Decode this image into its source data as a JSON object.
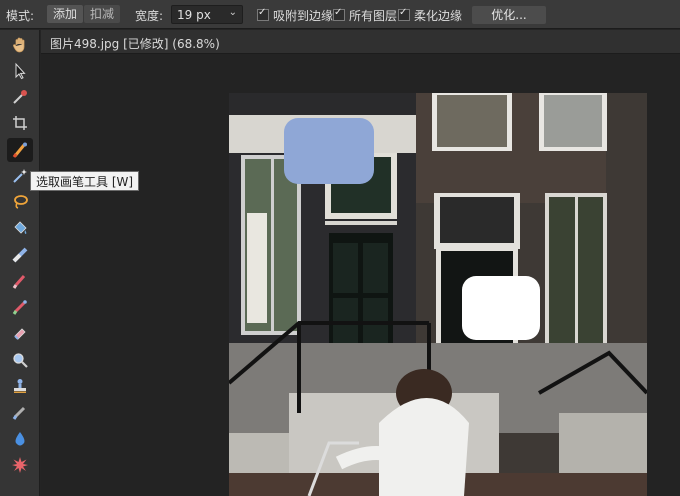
{
  "options_bar": {
    "mode_label": "模式:",
    "add_label": "添加",
    "subtract_label": "扣减",
    "width_label": "宽度:",
    "width_value": "19 px",
    "snap_edges_label": "吸附到边缘",
    "all_layers_label": "所有图层",
    "smooth_edges_label": "柔化边缘",
    "optimize_label": "优化..."
  },
  "document": {
    "tab_title": "图片498.jpg [已修改] (68.8%)"
  },
  "tooltip": {
    "text": "选取画笔工具 [W]"
  },
  "toolbar": {
    "tools": [
      {
        "name": "hand-tool-icon"
      },
      {
        "name": "move-arrow-icon"
      },
      {
        "name": "eyedropper-icon"
      },
      {
        "name": "crop-icon"
      },
      {
        "name": "selection-brush-icon",
        "active": true
      },
      {
        "name": "magic-wand-icon"
      },
      {
        "name": "lasso-icon"
      },
      {
        "name": "bucket-fill-icon"
      },
      {
        "name": "gradient-icon"
      },
      {
        "name": "brush-icon"
      },
      {
        "name": "healing-brush-icon"
      },
      {
        "name": "eraser-icon"
      },
      {
        "name": "zoom-icon"
      },
      {
        "name": "stamp-icon"
      },
      {
        "name": "smudge-icon"
      },
      {
        "name": "blur-drop-icon"
      },
      {
        "name": "burst-icon"
      }
    ]
  },
  "colors": {
    "selection_blue": "#8fa7d6",
    "selection_white": "#ffffff"
  }
}
